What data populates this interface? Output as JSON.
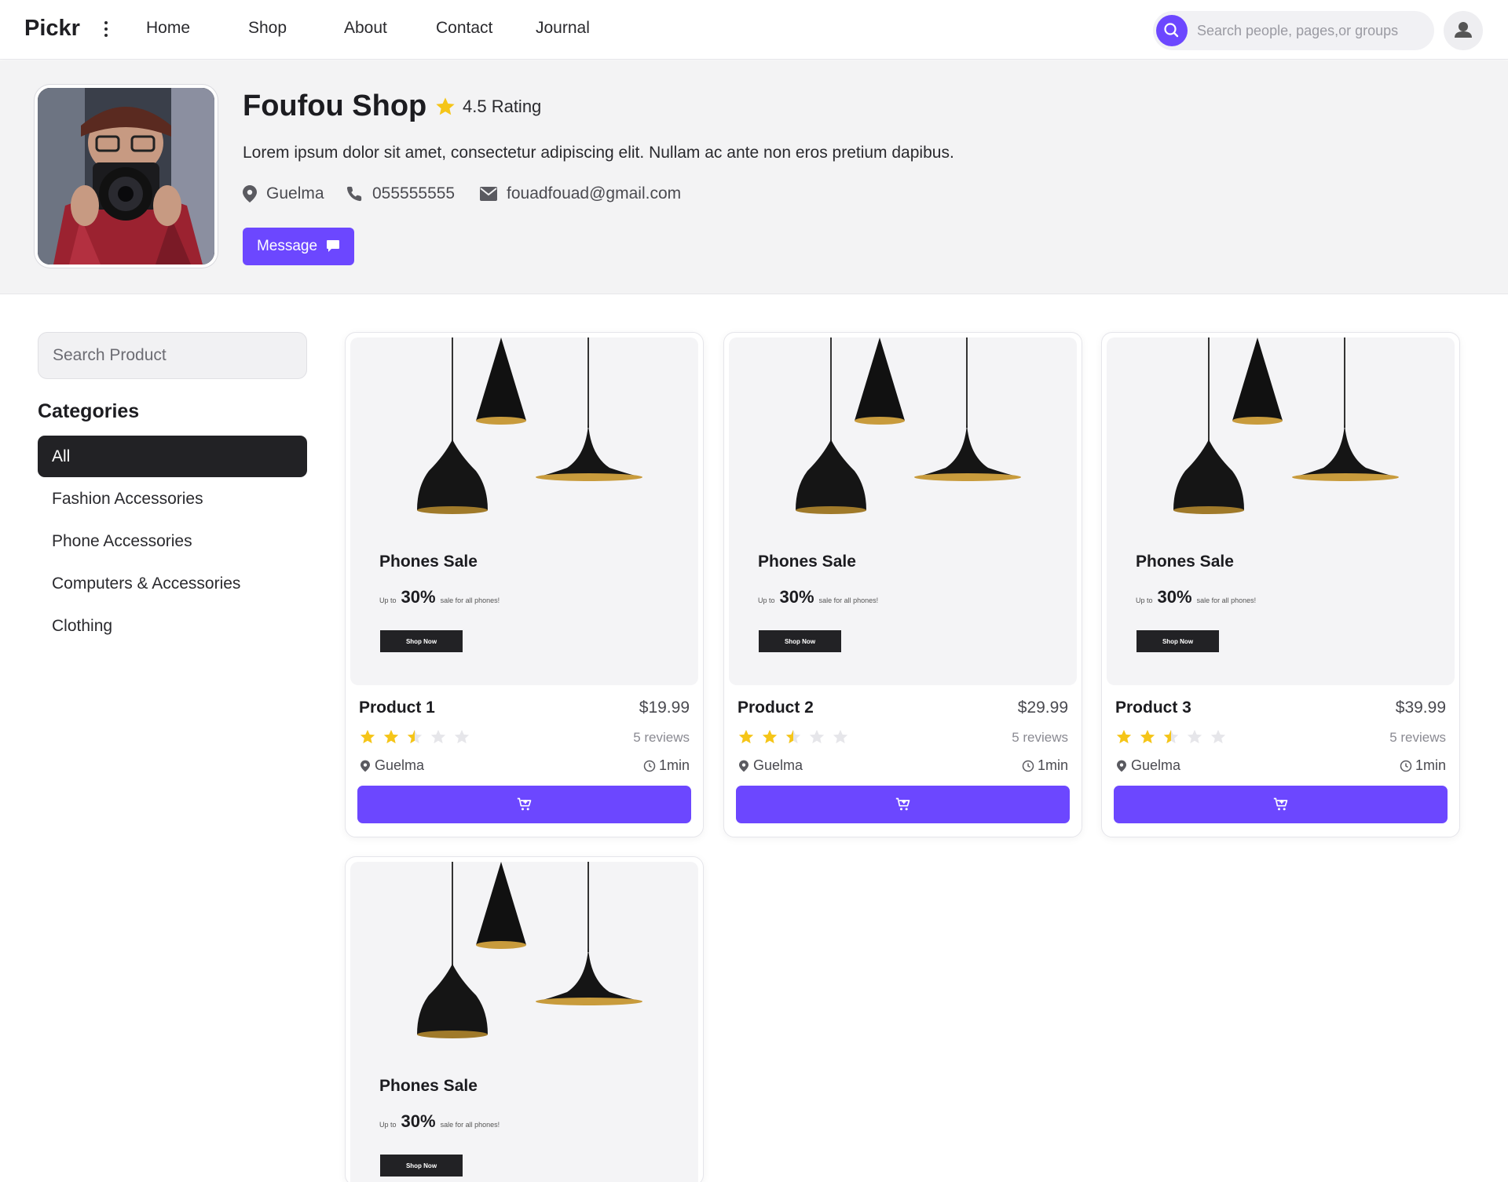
{
  "brand": "Pickr",
  "nav": {
    "links": [
      "Home",
      "Shop",
      "About",
      "Contact",
      "Journal"
    ],
    "search_placeholder": "Search people, pages,or groups"
  },
  "shop": {
    "name": "Foufou Shop",
    "rating": "4.5 Rating",
    "description": "Lorem ipsum dolor sit amet, consectetur adipiscing elit. Nullam ac ante non eros pretium dapibus.",
    "location": "Guelma",
    "phone": "055555555",
    "email": "fouadfouad@gmail.com",
    "message_label": "Message"
  },
  "sidebar": {
    "search_placeholder": "Search Product",
    "categories_title": "Categories",
    "categories": [
      "All",
      "Fashion Accessories",
      "Phone Accessories",
      "Computers & Accessories",
      "Clothing"
    ],
    "active_category": "All"
  },
  "promo": {
    "title": "Phones Sale",
    "prefix": "Up to",
    "percent": "30%",
    "suffix": "sale for all phones!",
    "button": "Shop Now"
  },
  "products": [
    {
      "name": "Product 1",
      "price": "$19.99",
      "rating": 2.5,
      "reviews": "5 reviews",
      "location": "Guelma",
      "time": "1min"
    },
    {
      "name": "Product 2",
      "price": "$29.99",
      "rating": 2.5,
      "reviews": "5 reviews",
      "location": "Guelma",
      "time": "1min"
    },
    {
      "name": "Product 3",
      "price": "$39.99",
      "rating": 2.5,
      "reviews": "5 reviews",
      "location": "Guelma",
      "time": "1min"
    },
    {
      "name": "",
      "price": "",
      "rating": 0,
      "reviews": "",
      "location": "",
      "time": ""
    }
  ],
  "colors": {
    "accent": "#6c47ff",
    "star": "#f5c518",
    "dark": "#222225"
  },
  "icons": {
    "search": "search-icon",
    "user": "user-icon",
    "star": "star-icon",
    "location": "map-pin-icon",
    "phone": "phone-icon",
    "email": "envelope-icon",
    "message": "chat-bubble-icon",
    "clock": "clock-icon",
    "cart": "cart-plus-icon"
  }
}
